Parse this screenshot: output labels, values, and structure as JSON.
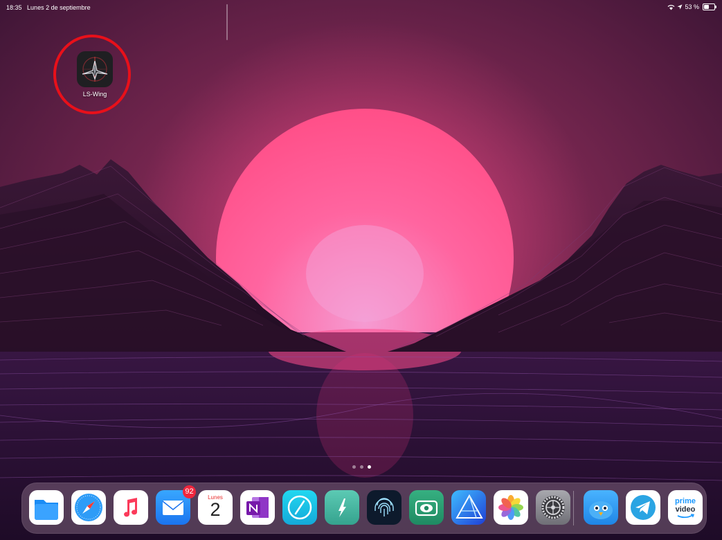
{
  "status": {
    "time": "18:35",
    "date": "Lunes 2 de septiembre",
    "battery": "53 %",
    "battery_level": 0.53
  },
  "home": {
    "apps": [
      {
        "label": "LS-Wing",
        "icon": "ls-wing-icon"
      }
    ]
  },
  "page_indicator": {
    "count": 3,
    "current": 3
  },
  "dock": {
    "apps": [
      {
        "icon": "files-icon",
        "color": "#1a8cf5"
      },
      {
        "icon": "safari-icon",
        "color": "#2e9cf7"
      },
      {
        "icon": "music-icon",
        "color": "#fb3a5a"
      },
      {
        "icon": "mail-icon",
        "color": "#2a8ef7",
        "badge": "92"
      },
      {
        "icon": "calendar-icon",
        "day": "Lunes",
        "date": "2"
      },
      {
        "icon": "onenote-icon",
        "color": "#8f36c6"
      },
      {
        "icon": "compass-app-icon",
        "color": "#1fc9e9"
      },
      {
        "icon": "vectornator-icon",
        "color": "#49b9a5"
      },
      {
        "icon": "fingerprint-icon",
        "color": "#0d1a2c"
      },
      {
        "icon": "viewer-icon",
        "color": "#2f9f73"
      },
      {
        "icon": "affinity-designer-icon",
        "color": "#2a5ff0"
      },
      {
        "icon": "photos-icon",
        "color": "#ffffff"
      },
      {
        "icon": "settings-icon",
        "color": "#8e8e93"
      },
      {
        "icon": "tweetbot-icon",
        "color": "#2b9cf1"
      },
      {
        "icon": "telegram-icon",
        "color": "#2aa4e3"
      },
      {
        "icon": "prime-video-icon",
        "color": "#ffffff",
        "text1": "prime",
        "text2": "video"
      }
    ]
  },
  "colors": {
    "highlight": "#e8101a",
    "sun": "#ff5f9a"
  }
}
